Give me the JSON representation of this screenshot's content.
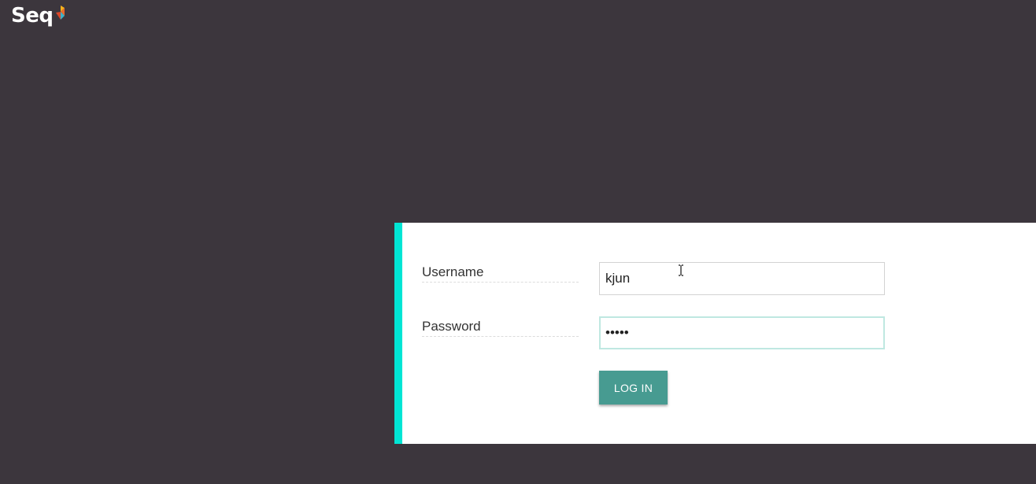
{
  "app": {
    "logo_text": "Seq",
    "logo_icon": "seq-flag-icon"
  },
  "login": {
    "username": {
      "label": "Username",
      "value": "kjun"
    },
    "password": {
      "label": "Password",
      "value": "•••••"
    },
    "submit_label": "LOG IN"
  },
  "colors": {
    "background": "#3c363d",
    "panel": "#ffffff",
    "accent": "#00e5d4",
    "button": "#479b91",
    "focus_border": "#bfe8e1"
  }
}
